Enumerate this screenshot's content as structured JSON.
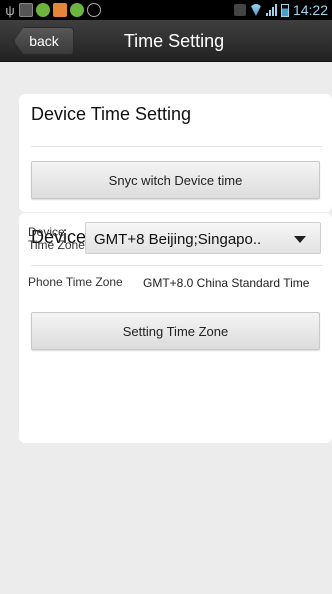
{
  "status_bar": {
    "time": "14:22",
    "icons": [
      "usb-icon",
      "document-icon",
      "green-app-icon",
      "orange-app-icon",
      "green-app-icon",
      "circle-icon",
      "mail-icon",
      "wifi-icon",
      "signal-icon",
      "battery-icon"
    ]
  },
  "header": {
    "back_label": "back",
    "title": "Time Setting"
  },
  "device_time": {
    "title": "Device Time Setting",
    "sync_button": "Snyc witch Device time"
  },
  "time_zone": {
    "title": "Device Time Zone Setting",
    "device_tz_label": "Device Time Zone",
    "device_tz_value": "GMT+8 Beijing;Singapo..",
    "phone_tz_label": "Phone Time Zone",
    "phone_tz_value": "GMT+8.0  China Standard Time",
    "set_button": "Setting Time Zone"
  },
  "colors": {
    "header_bg": "#2e2e2e",
    "page_bg": "#ececec",
    "card_bg": "#ffffff",
    "status_accent": "#9fd3ea"
  }
}
